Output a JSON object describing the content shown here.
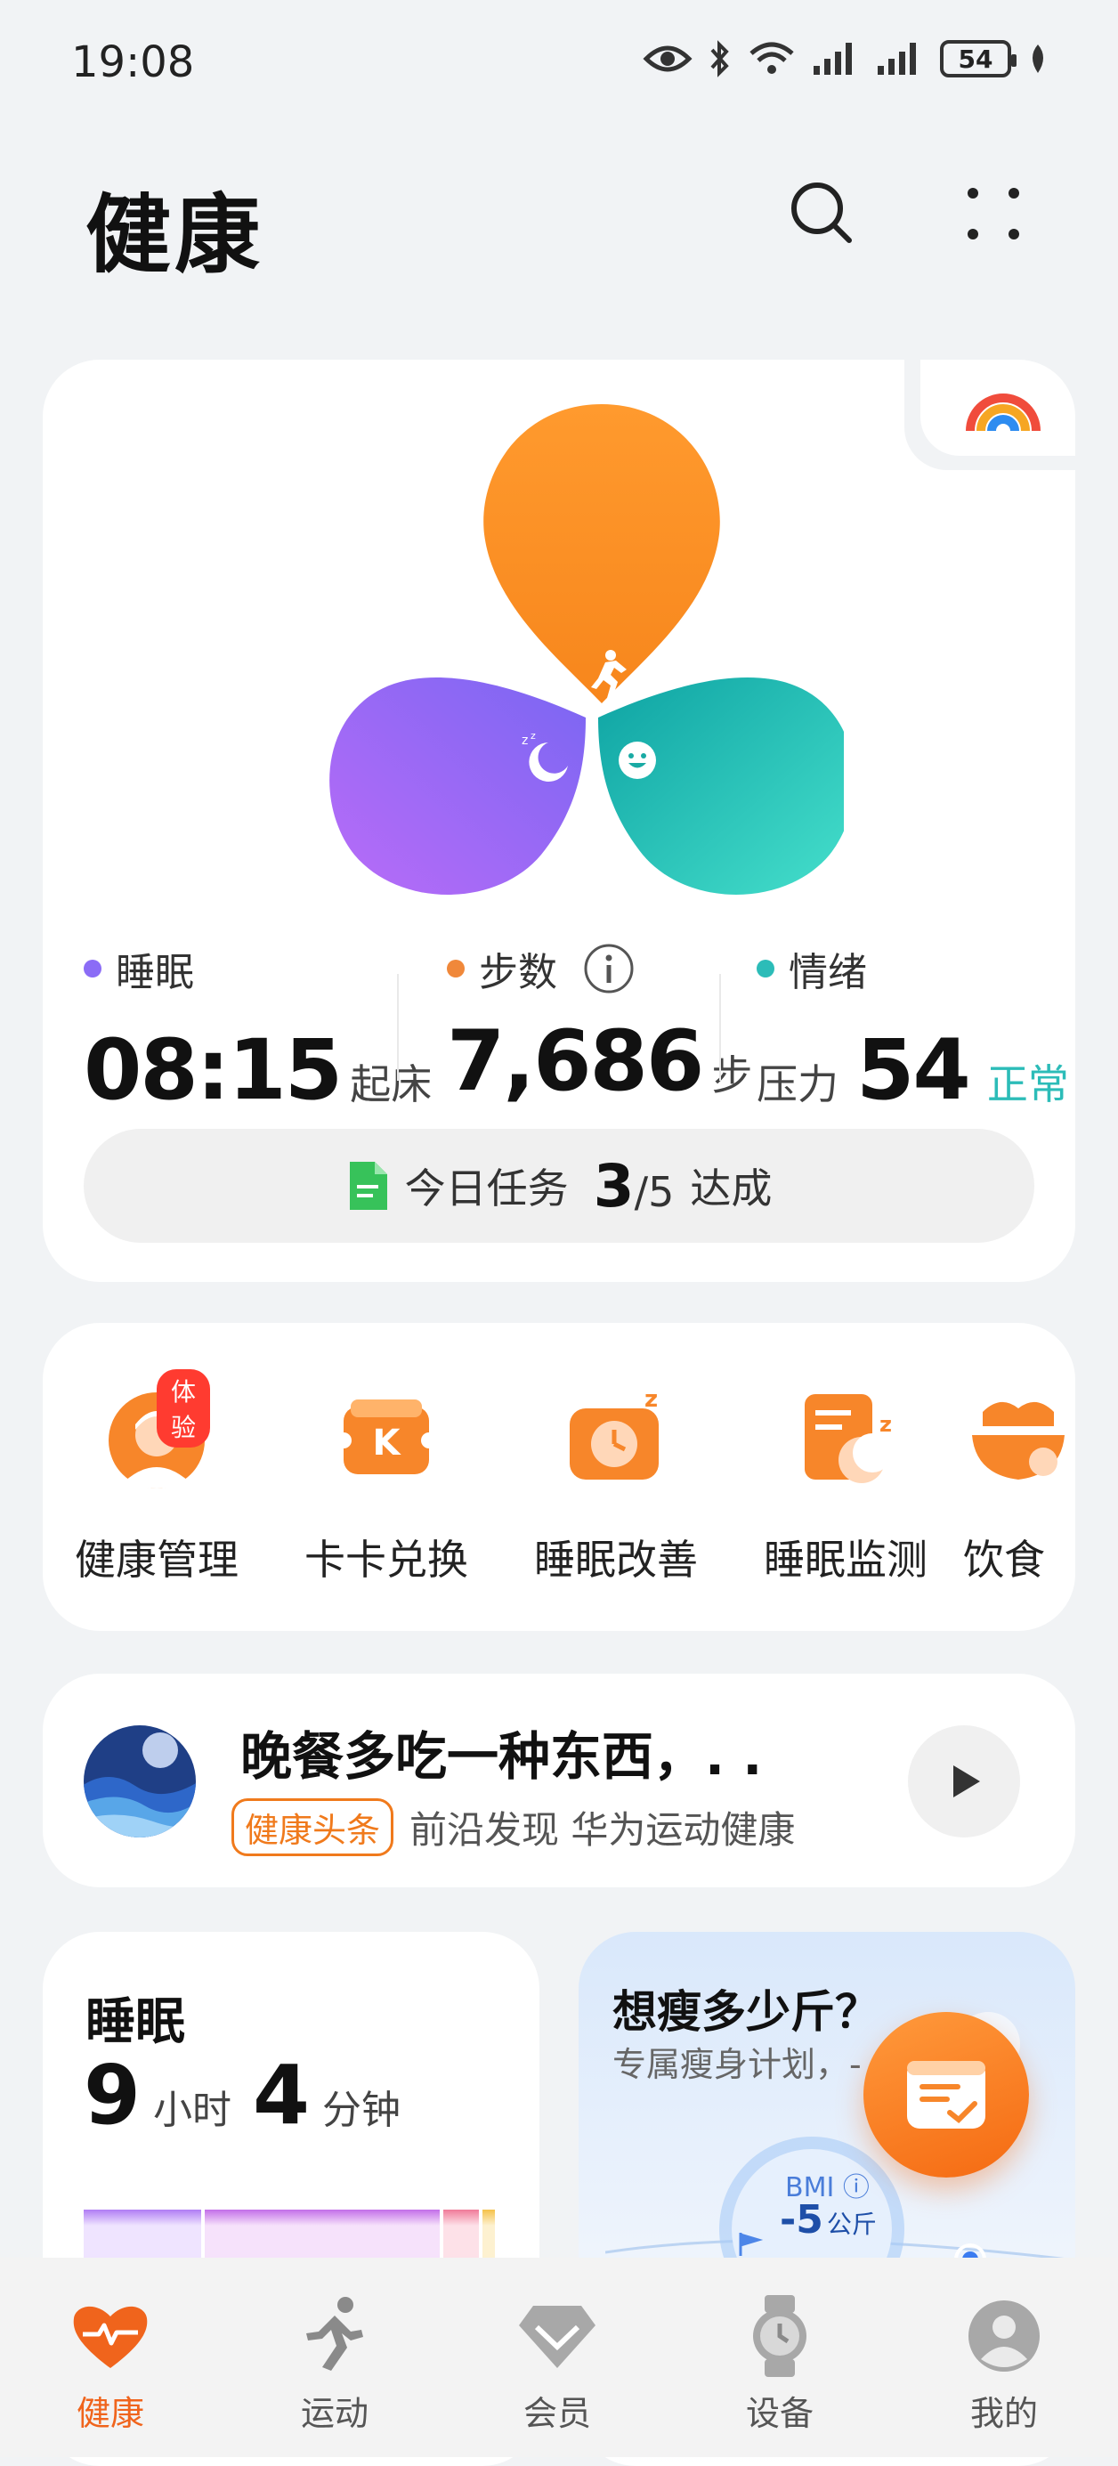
{
  "status_bar": {
    "time": "19:08",
    "battery": "54"
  },
  "header": {
    "title": "健康"
  },
  "summary": {
    "sleep": {
      "label": "睡眠",
      "value": "08:15",
      "unit": "起床",
      "color": "#8b6cf6"
    },
    "steps": {
      "label": "步数",
      "value": "7,686",
      "unit": "步",
      "color": "#f0883a"
    },
    "mood": {
      "label": "情绪",
      "prefix": "压力",
      "value": "54",
      "status": "正常",
      "color": "#2cbcb8",
      "status_color": "#2cbcb8"
    },
    "task": {
      "label": "今日任务",
      "done": "3",
      "total": "/5",
      "suffix": "达成"
    }
  },
  "shortcuts": [
    {
      "label": "健康管理",
      "badge": "体验",
      "icon": "health-manager-icon"
    },
    {
      "label": "卡卡兑换",
      "icon": "card-exchange-icon"
    },
    {
      "label": "睡眠改善",
      "icon": "sleep-improve-icon"
    },
    {
      "label": "睡眠监测",
      "icon": "sleep-monitor-icon"
    },
    {
      "label": "饮食",
      "icon": "diet-icon"
    }
  ],
  "news": {
    "title": "晚餐多吃一种东西，. .",
    "tag": "健康头条",
    "source": "前沿发现 华为运动健康"
  },
  "sleep_card": {
    "title": "睡眠",
    "hours": "9",
    "hours_unit": "小时",
    "minutes": "4",
    "minutes_unit": "分钟"
  },
  "weight_card": {
    "title": "想瘦多少斤？",
    "subtitle": "专属瘦身计划，-",
    "bmi_label": "BMI",
    "bmi_value": "-5",
    "bmi_unit": "公斤"
  },
  "bottom_nav": [
    {
      "label": "健康",
      "icon": "heart-pulse-icon",
      "active": true
    },
    {
      "label": "运动",
      "icon": "running-icon",
      "active": false
    },
    {
      "label": "会员",
      "icon": "diamond-icon",
      "active": false
    },
    {
      "label": "设备",
      "icon": "watch-icon",
      "active": false
    },
    {
      "label": "我的",
      "icon": "profile-icon",
      "active": false
    }
  ],
  "colors": {
    "accent": "#f0641c",
    "sleep": "#8b6cf6",
    "steps": "#f0883a",
    "mood": "#2cbcb8"
  }
}
